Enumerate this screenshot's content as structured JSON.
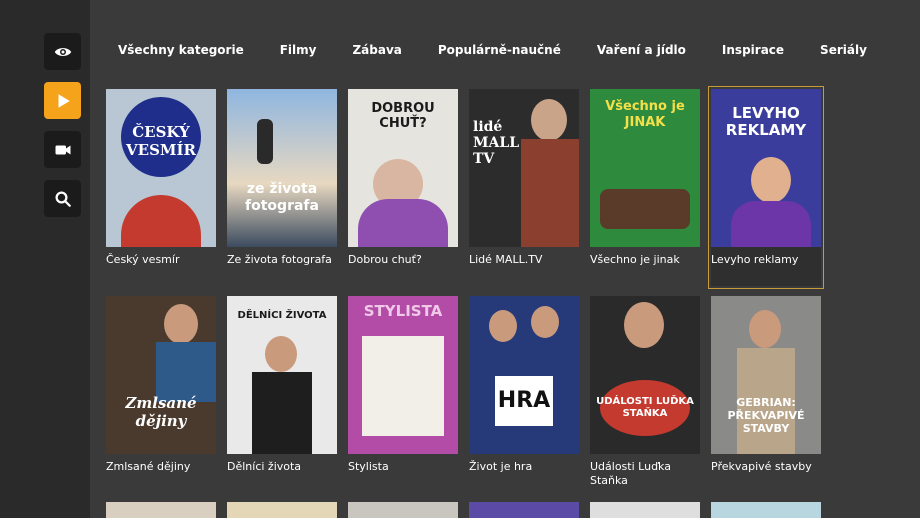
{
  "sidebar": {
    "items": [
      {
        "icon": "eye-icon",
        "active": false
      },
      {
        "icon": "play-icon",
        "active": true
      },
      {
        "icon": "video-camera-icon",
        "active": false
      },
      {
        "icon": "search-icon",
        "active": false
      }
    ],
    "accent": "#f4a31a"
  },
  "tabs": [
    "Všechny kategorie",
    "Filmy",
    "Zábava",
    "Populárně-naučné",
    "Vaření a jídlo",
    "Inspirace",
    "Seriály"
  ],
  "rows": [
    [
      {
        "title": "Český vesmír",
        "poster": "ČESKÝ VESMÍR",
        "bg": "#b8c7d3"
      },
      {
        "title": "Ze života fotografa",
        "poster": "ze života fotografa",
        "bg": "#5d7ea5"
      },
      {
        "title": "Dobrou chuť?",
        "poster": "DOBROU CHUŤ?",
        "bg": "#e6e4df"
      },
      {
        "title": "Lidé MALL.TV",
        "poster": "lidé MALL TV",
        "bg": "#2c2c2c"
      },
      {
        "title": "Všechno je jinak",
        "poster": "Všechno je JINAK",
        "bg": "#2e8a3c"
      },
      {
        "title": "Levyho reklamy",
        "poster": "LEVYHO REKLAMY",
        "bg": "#3b3d9c"
      }
    ],
    [
      {
        "title": "Zmlsané dějiny",
        "poster": "Zmlsané dějiny",
        "bg": "#4a3a2e"
      },
      {
        "title": "Dělníci života",
        "poster": "DĚLNÍCI ŽIVOTA",
        "bg": "#e9e9e9"
      },
      {
        "title": "Stylista",
        "poster": "STYLISTA",
        "bg": "#b24ca6"
      },
      {
        "title": "Život je hra",
        "poster": "HRA",
        "bg": "#263a7a"
      },
      {
        "title": "Události Luďka Staňka",
        "poster": "UDÁLOSTI LUĎKA STAŇKA",
        "bg": "#2a2a2a"
      },
      {
        "title": "Překvapivé stavby",
        "poster": "GEBRIAN: PŘEKVAPIVÉ STAVBY",
        "bg": "#8a8a88"
      }
    ]
  ]
}
